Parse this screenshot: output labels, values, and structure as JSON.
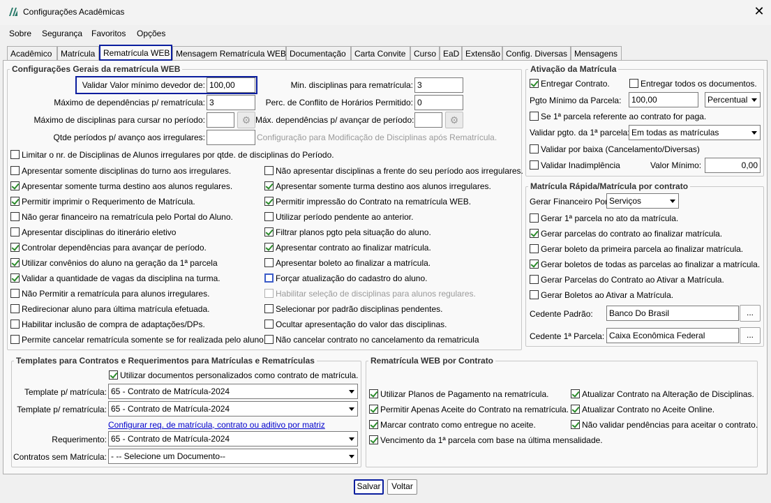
{
  "window": {
    "title": "Configurações Acadêmicas",
    "close_glyph": "✕"
  },
  "menu": [
    "Sobre",
    "Segurança",
    "Favoritos",
    "Opções"
  ],
  "tabs": [
    "Acadêmico",
    "Matrícula",
    "Rematrícula WEB",
    "Mensagem Rematrícula WEB",
    "Documentação",
    "Carta Convite",
    "Curso",
    "EaD",
    "Extensão",
    "Config. Diversas",
    "Mensagens"
  ],
  "active_tab": "Rematrícula WEB",
  "general": {
    "title": "Configurações Gerais da rematrícula WEB",
    "min_debt_label": "Validar Valor mínimo devedor de:",
    "min_debt_value": "100,00",
    "max_dep_label": "Máximo de dependências p/ rematrícula:",
    "max_dep_value": "3",
    "max_disc_label": "Máximo de disciplinas para cursar no período:",
    "max_disc_value": "",
    "qtde_label": "Qtde períodos p/ avanço aos irregulares:",
    "qtde_value": "",
    "min_disc_label": "Min. disciplinas para rematrícula:",
    "min_disc_value": "3",
    "perc_label": "Perc. de Conflito de Horários Permitido:",
    "perc_value": "0",
    "max_dep_adv_label": "Máx. dependências p/ avançar de período:",
    "max_dep_adv_value": "",
    "config_mod_label": "Configuração para Modificação de Disciplinas após Rematrícula.",
    "limitar_label": "Limitar o nr. de Disciplinas de Alunos irregulares por qtde. de disciplinas do Período.",
    "left_checks": [
      {
        "label": "Apresentar somente disciplinas do turno aos irregulares.",
        "checked": false
      },
      {
        "label": "Apresentar somente turma destino aos alunos regulares.",
        "checked": true
      },
      {
        "label": "Permitir imprimir o Requerimento de Matrícula.",
        "checked": true
      },
      {
        "label": "Não gerar financeiro na rematrícula pelo Portal do Aluno.",
        "checked": false
      },
      {
        "label": "Apresentar disciplinas do itinerário eletivo",
        "checked": false
      },
      {
        "label": "Controlar dependências para avançar de período.",
        "checked": true
      },
      {
        "label": "Utilizar convênios do aluno na geração da 1ª parcela",
        "checked": true
      },
      {
        "label": "Validar a quantidade de vagas da disciplina na turma.",
        "checked": true
      },
      {
        "label": "Não Permitir a rematrícula para alunos irregulares.",
        "checked": false
      },
      {
        "label": "Redirecionar aluno para última matrícula efetuada.",
        "checked": false
      },
      {
        "label": "Habilitar inclusão de compra de adaptações/DPs.",
        "checked": false
      },
      {
        "label": "Permite cancelar rematrícula somente se for realizada pelo aluno.",
        "checked": false
      }
    ],
    "right_checks": [
      {
        "label": "Não apresentar disciplinas a frente do seu período aos irregulares.",
        "checked": false
      },
      {
        "label": "Apresentar somente turma destino aos alunos irregulares.",
        "checked": true
      },
      {
        "label": "Permitir impressão do Contrato na rematrícula WEB.",
        "checked": true
      },
      {
        "label": "Utilizar período pendente ao anterior.",
        "checked": false
      },
      {
        "label": "Filtrar planos pgto pela situação do aluno.",
        "checked": true
      },
      {
        "label": "Apresentar contrato ao finalizar matrícula.",
        "checked": true
      },
      {
        "label": "Apresentar boleto ao finalizar a matrícula.",
        "checked": false
      },
      {
        "label": "Forçar atualização do cadastro do aluno.",
        "checked": false
      },
      {
        "label": "Habilitar seleção de disciplinas para alunos regulares.",
        "checked": false,
        "disabled": true
      },
      {
        "label": "Selecionar por padrão disciplinas pendentes.",
        "checked": false
      },
      {
        "label": "Ocultar apresentação do valor das disciplinas.",
        "checked": false
      },
      {
        "label": "Não cancelar contrato no cancelamento da rematricula",
        "checked": false
      }
    ]
  },
  "activation": {
    "title": "Ativação da Matrícula",
    "entregar_contrato": "Entregar Contrato.",
    "entregar_todos": "Entregar todos os documentos.",
    "pgto_min_label": "Pgto Mínimo da Parcela:",
    "pgto_min_value": "100,00",
    "pgto_min_type": "Percentual",
    "se_primeira": "Se 1ª parcela referente ao contrato for paga.",
    "validar_pgto_label": "Validar pgto. da 1ª parcela:",
    "validar_pgto_value": "Em todas as matrículas",
    "validar_baixa": "Validar por baixa (Cancelamento/Diversas)",
    "validar_inad": "Validar Inadimplência",
    "valor_min_label": "Valor Mínimo:",
    "valor_min_value": "0,00"
  },
  "rapida": {
    "title": "Matrícula Rápida/Matrícula por contrato",
    "gerar_fin_label": "Gerar Financeiro Por:",
    "gerar_fin_value": "Serviços",
    "checks": [
      {
        "label": "Gerar 1ª parcela no ato da matrícula.",
        "checked": false
      },
      {
        "label": "Gerar parcelas do contrato ao finalizar matrícula.",
        "checked": true
      },
      {
        "label": "Gerar boleto da primeira parcela ao finalizar matrícula.",
        "checked": false
      },
      {
        "label": "Gerar boletos de todas as parcelas ao finalizar a matrícula.",
        "checked": true
      },
      {
        "label": "Gerar Parcelas do Contrato ao Ativar a Matrícula.",
        "checked": false
      },
      {
        "label": "Gerar Boletos ao Ativar a Matrícula.",
        "checked": false
      }
    ],
    "cedente_label": "Cedente Padrão:",
    "cedente_value": "Banco Do Brasil",
    "cedente1_label": "Cedente 1ª Parcela:",
    "cedente1_value": "Caixa Econômica Federal",
    "dots": "..."
  },
  "templates": {
    "title": "Templates para Contratos e Requerimentos para Matrículas e Rematrículas",
    "utilizar_docs": "Utilizar documentos personalizados como contrato de matrícula.",
    "tpl_mat_label": "Template p/ matrícula:",
    "tpl_mat_value": "65 - Contrato de Matrícula-2024",
    "tpl_remat_label": "Template p/ rematrícula:",
    "tpl_remat_value": "65 - Contrato de Matrícula-2024",
    "config_link": "Configurar req. de matrícula, contrato ou aditivo por matriz",
    "req_label": "Requerimento:",
    "req_value": "65 - Contrato de Matrícula-2024",
    "sem_mat_label": "Contratos sem Matrícula:",
    "sem_mat_value": "- -- Selecione um Documento--"
  },
  "webcontrato": {
    "title": "Rematrícula WEB por Contrato",
    "left": [
      "Utilizar Planos de Pagamento na rematrícula.",
      "Permitir Apenas Aceite do Contrato na rematrícula.",
      "Marcar contrato como entregue no aceite.",
      "Vencimento da 1ª parcela com base na última mensalidade."
    ],
    "right": [
      "Atualizar Contrato na Alteração de Disciplinas.",
      "Atualizar Contrato no Aceite Online.",
      "Não validar pendências para aceitar o contrato."
    ]
  },
  "buttons": {
    "save": "Salvar",
    "back": "Voltar"
  }
}
